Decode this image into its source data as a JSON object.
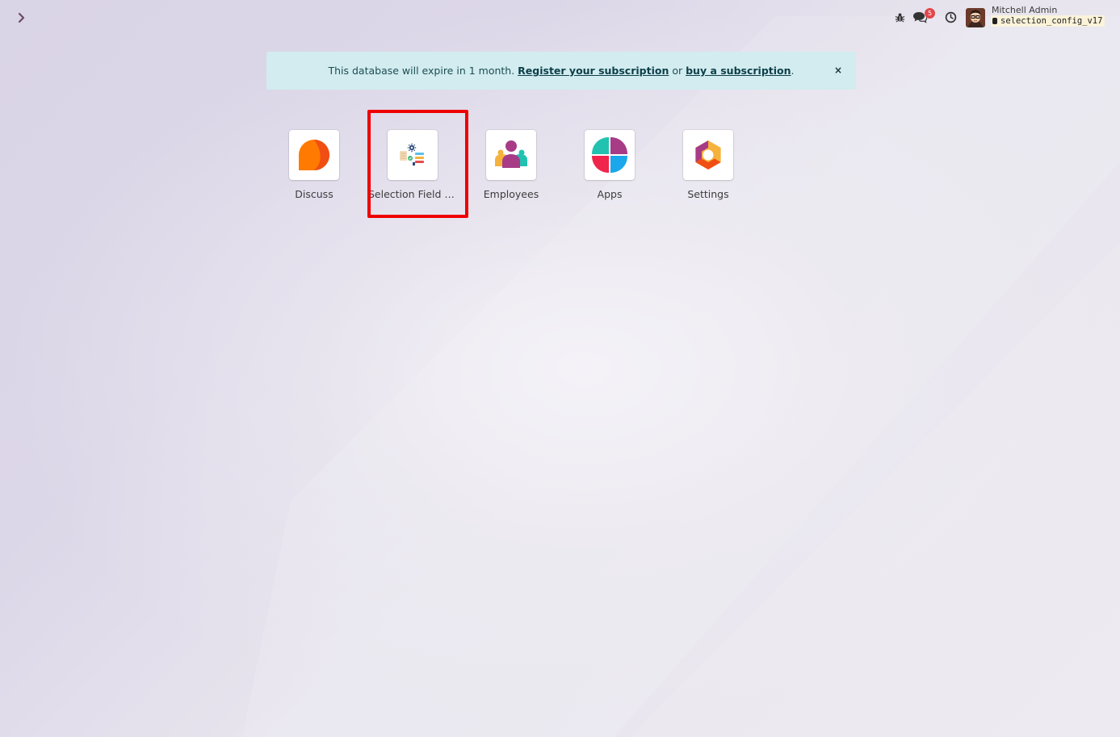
{
  "systray": {
    "debug_icon": "bug-icon",
    "messages_icon": "chat-bubbles-icon",
    "messages_count": "5",
    "activity_icon": "clock-icon",
    "user_name": "Mitchell Admin",
    "database": "selection_config_v17"
  },
  "banner": {
    "prefix": "This database will expire in 1 month. ",
    "register_link": "Register your subscription",
    "middle": " or ",
    "buy_link": "buy a subscription",
    "suffix": ".",
    "close": "×"
  },
  "apps": [
    {
      "label": "Discuss",
      "icon": "discuss-icon"
    },
    {
      "label": "Selection Field Configuration",
      "icon": "selection-field-config-icon"
    },
    {
      "label": "Employees",
      "icon": "employees-icon"
    },
    {
      "label": "Apps",
      "icon": "apps-icon"
    },
    {
      "label": "Settings",
      "icon": "settings-icon"
    }
  ],
  "colors": {
    "highlight": "#ee0000",
    "banner_bg": "#d2ecef",
    "badge": "#e2464b"
  }
}
